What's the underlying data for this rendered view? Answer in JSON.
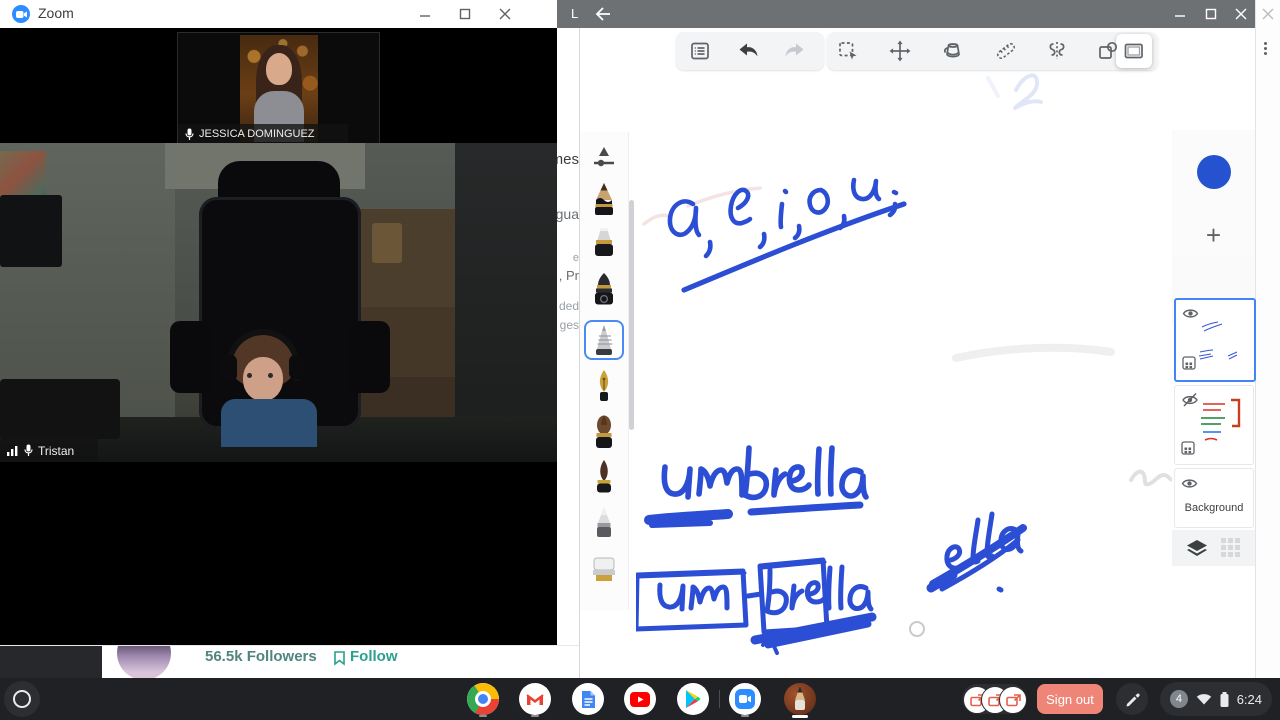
{
  "zoom": {
    "title": "Zoom",
    "thumbnail_participant": "JESSICA DOMINGUEZ",
    "main_participant": "Tristan"
  },
  "background_page": {
    "tab_letter": "L",
    "fragments": [
      "mes",
      "gua",
      "e",
      ", Pr",
      "ded",
      "ges"
    ],
    "followers": "56.5k Followers",
    "follow_label": "Follow"
  },
  "canvas_app": {
    "ink_color": "#2b4ed4",
    "ink_line1": "a, e, i, o, u",
    "ink_word1": "umbrella",
    "ink_word2_part1": "um",
    "ink_word2_part2": "brella",
    "ink_word3": "ella",
    "add_layer_glyph": "+",
    "color_current": "#2553cf",
    "layers": {
      "background_label": "Background"
    },
    "toolbar_icons": [
      "menu",
      "undo",
      "redo",
      "select",
      "move",
      "fill",
      "ruler",
      "symmetry",
      "insert-image",
      "frame"
    ],
    "tools": [
      "pen-settings",
      "pencil",
      "chisel-marker",
      "airbrush",
      "ballpoint-pen",
      "fountain-pen",
      "round-brush",
      "pointed-brush",
      "pastel",
      "flat-marker"
    ],
    "selected_tool": "ballpoint-pen"
  },
  "taskbar": {
    "apps": [
      "chrome",
      "gmail",
      "docs",
      "youtube",
      "play-store",
      "zoom",
      "canvas"
    ],
    "sign_out_label": "Sign out",
    "notification_count": "4",
    "time": "6:24"
  }
}
